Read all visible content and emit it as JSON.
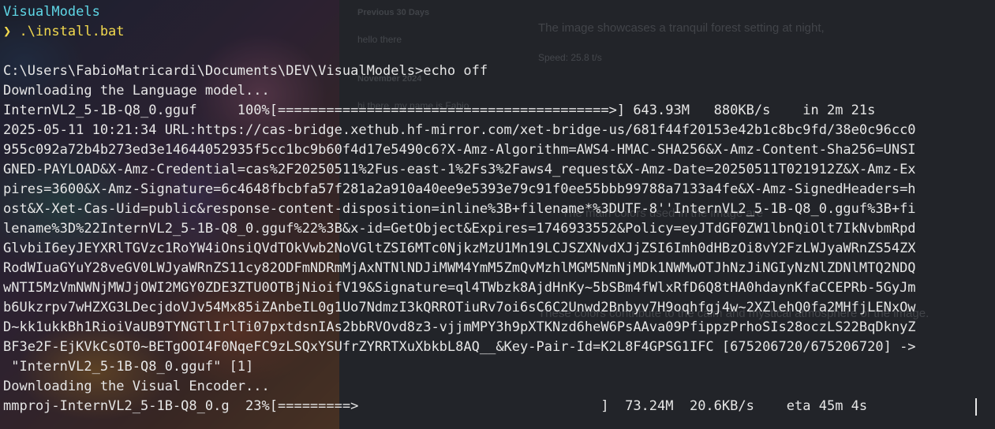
{
  "background_app": {
    "sidebar_heading_1": "Previous 30 Days",
    "sidebar_item_1": "hello there",
    "sidebar_heading_2": "November 2024",
    "sidebar_item_2": "hi there, my name is Fabio",
    "chat_line_1": "The image showcases a tranquil forest setting at night,",
    "chat_speed": "Speed: 25.8 t/s",
    "chat_line_2": "The main colors used in the image are",
    "chat_line_3": "These colors contribute to the calm and mystical atmosphere of the image."
  },
  "terminal": {
    "lines": [
      {
        "text": "VisualModels",
        "style": "cyan"
      },
      {
        "text": "❯ .\\install.bat",
        "style": "prompt"
      },
      {
        "text": "",
        "style": "normal"
      },
      {
        "text": "C:\\Users\\FabioMatricardi\\Documents\\DEV\\VisualModels>echo off",
        "style": "normal"
      },
      {
        "text": "Downloading the Language model...",
        "style": "normal"
      },
      {
        "text": "InternVL2_5-1B-Q8_0.gguf     100%[=========================================>] 643.93M   880KB/s    in 2m 21s",
        "style": "normal"
      },
      {
        "text": "2025-05-11 10:21:34 URL:https://cas-bridge.xethub.hf-mirror.com/xet-bridge-us/681f44f20153e42b1c8bc9fd/38e0c96cc0",
        "style": "normal"
      },
      {
        "text": "955c092a72b4b273ed3e14644052935f5cc1bc9b60f4d17e5490c6?X-Amz-Algorithm=AWS4-HMAC-SHA256&X-Amz-Content-Sha256=UNSI",
        "style": "normal"
      },
      {
        "text": "GNED-PAYLOAD&X-Amz-Credential=cas%2F20250511%2Fus-east-1%2Fs3%2Faws4_request&X-Amz-Date=20250511T021912Z&X-Amz-Ex",
        "style": "normal"
      },
      {
        "text": "pires=3600&X-Amz-Signature=6c4648fbcbfa57f281a2a910a40ee9e5393e79c91f0ee55bbb99788a7133a4fe&X-Amz-SignedHeaders=h",
        "style": "normal"
      },
      {
        "text": "ost&X-Xet-Cas-Uid=public&response-content-disposition=inline%3B+filename*%3DUTF-8''InternVL2_5-1B-Q8_0.gguf%3B+fi",
        "style": "normal"
      },
      {
        "text": "lename%3D%22InternVL2_5-1B-Q8_0.gguf%22%3B&x-id=GetObject&Expires=1746933552&Policy=eyJTdGF0ZW1lbnQiOlt7IkNvbmRpd",
        "style": "normal"
      },
      {
        "text": "GlvbiI6eyJEYXRlTGVzc1RoYW4iOnsiQVdTOkVwb2NoVGltZSI6MTc0NjkzMzU1Mn19LCJSZXNvdXJjZSI6Imh0dHBzOi8vY2FzLWJyaWRnZS54ZX",
        "style": "normal"
      },
      {
        "text": "RodWIuaGYuY28veGV0LWJyaWRnZS11cy82ODFmNDRmMjAxNTNlNDJiMWM4YmM5ZmQvMzhlMGM5NmNjMDk1NWMwOTJhNzJiNGIyNzNlZDNlMTQ2NDQ",
        "style": "normal"
      },
      {
        "text": "wNTI5MzVmNWNjMWJjOWI2MGY0ZDE3ZTU0OTBjNioifV19&Signature=ql4TWbzk8AjdHnKy~5bSBm4fWlxRfD6Q8tHA0hdaynKfaCCEPRb-5GyJm",
        "style": "normal"
      },
      {
        "text": "b6Ukzrpv7wHZXG3LDecjdoVJv54Mx85iZAnbeIL0g1Uo7NdmzI3kQRROTiuRv7oi6sC6C2Unwd2Bnbyv7H9oqhfgj4w~2XZlehQ0fa2MHfjLENxOw",
        "style": "normal"
      },
      {
        "text": "D~kk1ukkBh1RioiVaUB9TYNGTlIrlTi07pxtdsnIAs2bbRVOvd8z3-vjjmMPY3h9pXTKNzd6heW6PsAAva09PfippzPrhoSIs28oczLS22BqDknyZ",
        "style": "normal"
      },
      {
        "text": "BF3e2F-EjKVkCsOT0~BETgOOI4F0NqeFC9zLSQxYSUfrZYRRTXuXbkbL8AQ__&Key-Pair-Id=K2L8F4GPSG1IFC [675206720/675206720] ->",
        "style": "normal"
      },
      {
        "text": " \"InternVL2_5-1B-Q8_0.gguf\" [1]",
        "style": "normal"
      },
      {
        "text": "Downloading the Visual Encoder...",
        "style": "normal"
      },
      {
        "text": "mmproj-InternVL2_5-1B-Q8_0.g  23%[=========>                              ]  73.24M  20.6KB/s    eta 45m 4s",
        "style": "normal"
      }
    ],
    "visual_encoder_progress_percent": 23
  }
}
